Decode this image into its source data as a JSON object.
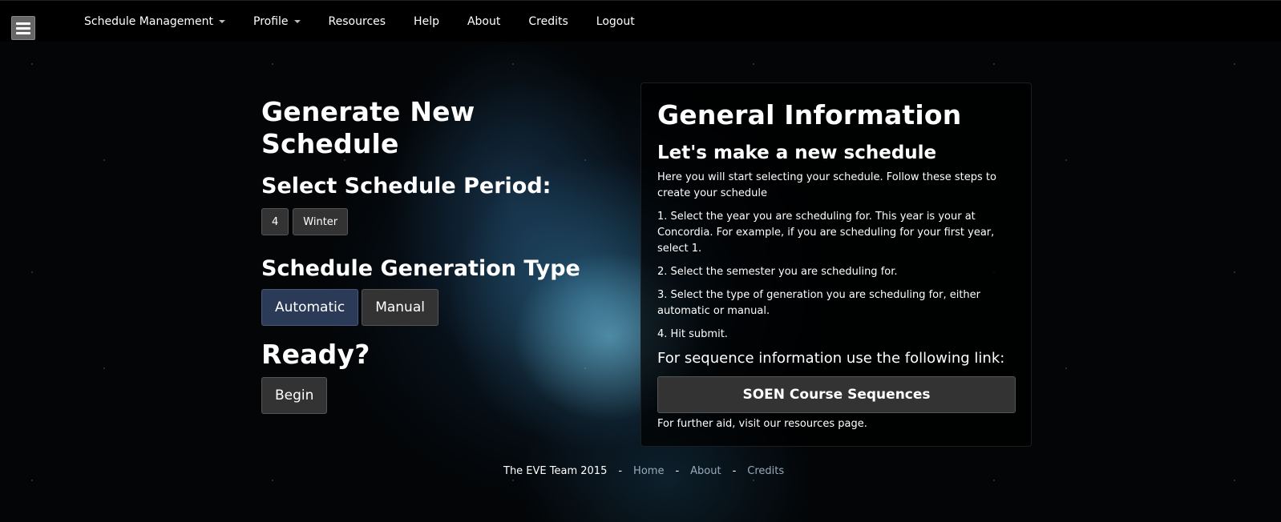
{
  "nav": {
    "items": [
      {
        "label": "Schedule Management",
        "dropdown": true
      },
      {
        "label": "Profile",
        "dropdown": true
      },
      {
        "label": "Resources",
        "dropdown": false
      },
      {
        "label": "Help",
        "dropdown": false
      },
      {
        "label": "About",
        "dropdown": false
      },
      {
        "label": "Credits",
        "dropdown": false
      },
      {
        "label": "Logout",
        "dropdown": false
      }
    ]
  },
  "left": {
    "title": "Generate New Schedule",
    "period_heading": "Select Schedule Period:",
    "year_value": "4",
    "semester_value": "Winter",
    "type_heading": "Schedule Generation Type",
    "type_options": [
      "Automatic",
      "Manual"
    ],
    "selected_type": "Automatic",
    "ready_heading": "Ready?",
    "begin_label": "Begin"
  },
  "panel": {
    "title": "General Information",
    "subtitle": "Let's make a new schedule",
    "intro": "Here you will start selecting your schedule. Follow these steps to create your schedule",
    "steps": [
      "1. Select the year you are scheduling for. This year is your at Concordia. For example, if you are scheduling for your first year, select 1.",
      "2. Select the semester you are scheduling for.",
      "3. Select the type of generation you are scheduling for, either automatic or manual.",
      "4. Hit submit."
    ],
    "sequence_heading": "For sequence information use the following link:",
    "sequence_button": "SOEN Course Sequences",
    "further_aid": "For further aid, visit our resources page."
  },
  "footer": {
    "team": "The EVE Team 2015",
    "separator": "-",
    "links": [
      "Home",
      "About",
      "Credits"
    ]
  },
  "colors": {
    "nav_bg": "#000000",
    "button_bg": "#333333",
    "active_button_bg": "#2b3b57",
    "footer_link": "#99aabb"
  }
}
